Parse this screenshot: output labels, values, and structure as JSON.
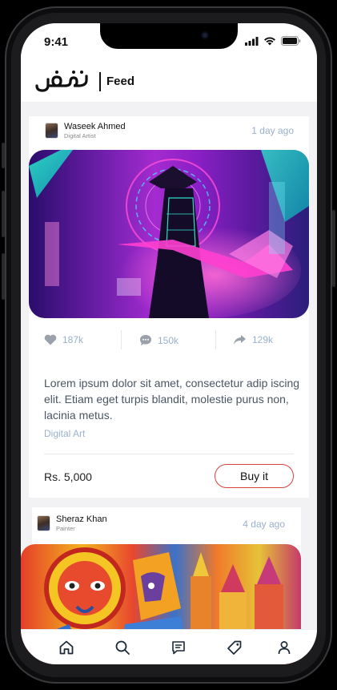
{
  "status_bar": {
    "time": "9:41"
  },
  "header": {
    "logo_text": "فنون",
    "title": "Feed"
  },
  "posts": [
    {
      "user_name": "Waseek Ahmed",
      "user_role": "Digital Artist",
      "time_ago": "1 day ago",
      "likes": "187k",
      "comments": "150k",
      "shares": "129k",
      "description": "Lorem ipsum dolor sit amet, consectetur adip iscing elit. Etiam eget turpis blandit, molestie purus non, lacinia metus.",
      "category": "Digital Art",
      "price": "Rs. 5,000",
      "buy_label": "Buy  it"
    },
    {
      "user_name": "Sheraz Khan",
      "user_role": "Painter",
      "time_ago": "4 day ago"
    }
  ],
  "tab_bar": {
    "items": [
      {
        "icon": "home-icon"
      },
      {
        "icon": "search-icon"
      },
      {
        "icon": "chat-icon"
      },
      {
        "icon": "tag-icon"
      },
      {
        "icon": "profile-icon"
      }
    ]
  },
  "colors": {
    "accent_border": "#d9413c",
    "muted_text": "#9ab0cc",
    "body_text": "#4a5564"
  }
}
